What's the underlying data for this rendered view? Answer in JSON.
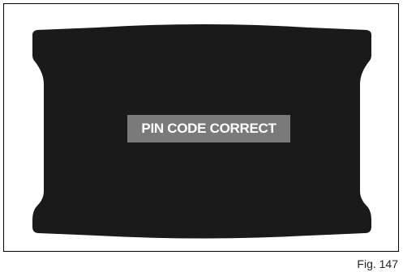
{
  "display": {
    "message": "PIN CODE CORRECT",
    "colors": {
      "screen": "#1a1a1a",
      "message_background": "#7a7a7a",
      "message_text": "#ffffff"
    }
  },
  "figure": {
    "caption": "Fig. 147"
  }
}
